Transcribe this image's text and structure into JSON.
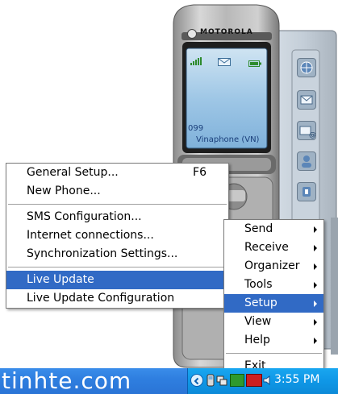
{
  "phone": {
    "brand": "MOTOROLA",
    "screen_number": "099",
    "carrier": "Vinaphone (VN)"
  },
  "main_menu": {
    "items": [
      {
        "label": "General Setup...",
        "shortcut": "F6"
      },
      {
        "label": "New Phone..."
      },
      {
        "label": "SMS Configuration..."
      },
      {
        "label": "Internet connections..."
      },
      {
        "label": "Synchronization Settings..."
      },
      {
        "label": "Live Update",
        "selected": true
      },
      {
        "label": "Live Update Configuration"
      }
    ]
  },
  "sub_menu": {
    "items": [
      {
        "label": "Send",
        "submenu": true
      },
      {
        "label": "Receive",
        "submenu": true
      },
      {
        "label": "Organizer",
        "submenu": true
      },
      {
        "label": "Tools",
        "submenu": true
      },
      {
        "label": "Setup",
        "submenu": true,
        "selected": true
      },
      {
        "label": "View",
        "submenu": true
      },
      {
        "label": "Help",
        "submenu": true
      },
      {
        "label": "Exit"
      }
    ]
  },
  "taskbar": {
    "watermark": "tinhte.com",
    "clock": "3:55 PM"
  },
  "colors": {
    "menu_highlight": "#316ac5",
    "taskbar": "#2f7fe0",
    "tray": "#0f97e6"
  }
}
